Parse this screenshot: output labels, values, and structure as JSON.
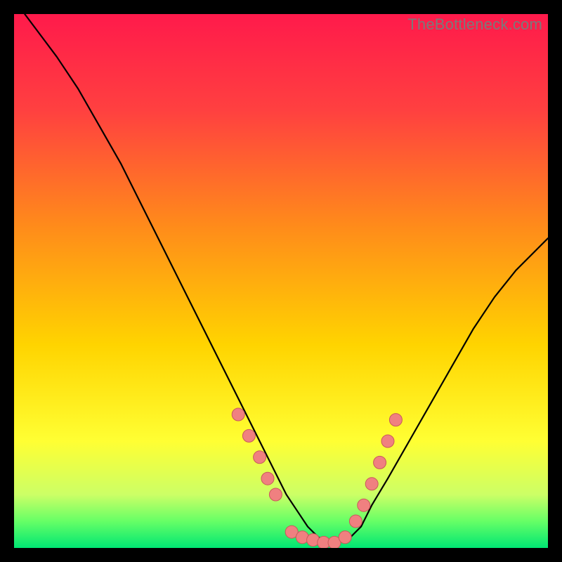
{
  "watermark": "TheBottleneck.com",
  "colors": {
    "frame": "#000000",
    "gradient_top": "#ff1a4b",
    "gradient_mid": "#ffd400",
    "gradient_green_light": "#aaff66",
    "gradient_green": "#00e673",
    "curve": "#000000",
    "marker_fill": "#f08080",
    "marker_stroke": "#c85a5a"
  },
  "chart_data": {
    "type": "line",
    "title": "",
    "xlabel": "",
    "ylabel": "",
    "xlim": [
      0,
      100
    ],
    "ylim": [
      0,
      100
    ],
    "x": [
      2,
      5,
      8,
      12,
      16,
      20,
      24,
      28,
      32,
      36,
      40,
      43,
      46,
      49,
      51,
      53,
      55,
      57,
      59,
      61,
      63,
      65,
      67,
      70,
      74,
      78,
      82,
      86,
      90,
      94,
      98,
      100
    ],
    "y": [
      100,
      96,
      92,
      86,
      79,
      72,
      64,
      56,
      48,
      40,
      32,
      26,
      20,
      14,
      10,
      7,
      4,
      2,
      1,
      1,
      2,
      4,
      8,
      13,
      20,
      27,
      34,
      41,
      47,
      52,
      56,
      58
    ],
    "markers": {
      "x": [
        42,
        44,
        46,
        47.5,
        49,
        52,
        54,
        56,
        58,
        60,
        62,
        64,
        65.5,
        67,
        68.5,
        70,
        71.5
      ],
      "y": [
        25,
        21,
        17,
        13,
        10,
        3,
        2,
        1.5,
        1,
        1,
        2,
        5,
        8,
        12,
        16,
        20,
        24
      ]
    },
    "gradient_stops": [
      {
        "offset": 0.0,
        "color": "#ff1a4b"
      },
      {
        "offset": 0.18,
        "color": "#ff4040"
      },
      {
        "offset": 0.4,
        "color": "#ff8c1a"
      },
      {
        "offset": 0.62,
        "color": "#ffd400"
      },
      {
        "offset": 0.8,
        "color": "#ffff33"
      },
      {
        "offset": 0.9,
        "color": "#ccff66"
      },
      {
        "offset": 0.95,
        "color": "#66ff66"
      },
      {
        "offset": 1.0,
        "color": "#00e673"
      }
    ]
  }
}
